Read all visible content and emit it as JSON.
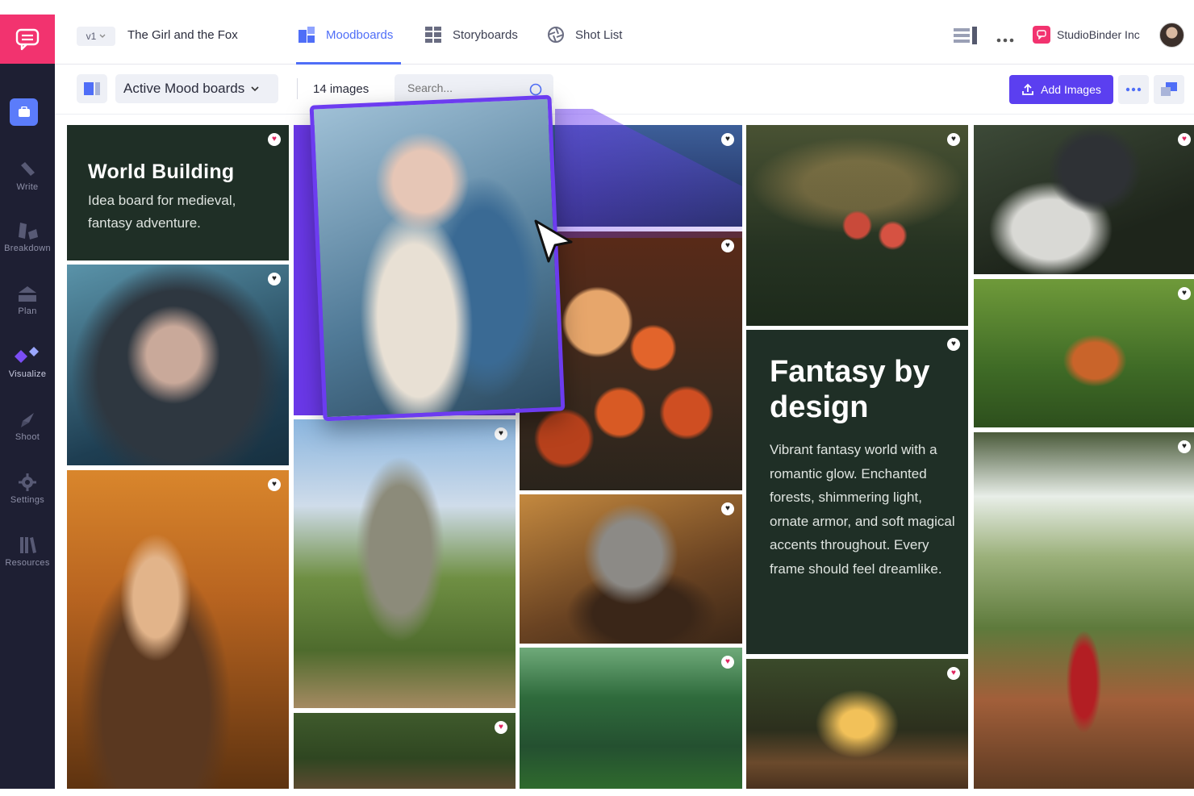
{
  "sidebar": {
    "items": [
      {
        "label": "Write",
        "icon": "pen-icon"
      },
      {
        "label": "Breakdown",
        "icon": "breakdown-icon"
      },
      {
        "label": "Plan",
        "icon": "plan-icon"
      },
      {
        "label": "Visualize",
        "icon": "visualize-icon"
      },
      {
        "label": "Shoot",
        "icon": "shoot-icon"
      },
      {
        "label": "Settings",
        "icon": "gear-icon"
      },
      {
        "label": "Resources",
        "icon": "books-icon"
      }
    ]
  },
  "header": {
    "version": "v1",
    "project_title": "The Girl and the Fox",
    "tabs": [
      {
        "label": "Moodboards",
        "active": true
      },
      {
        "label": "Storyboards",
        "active": false
      },
      {
        "label": "Shot List",
        "active": false
      }
    ],
    "company": "StudioBinder Inc"
  },
  "toolbar": {
    "board_select": "Active Mood boards",
    "image_count": "14 images",
    "search_placeholder": "Search...",
    "add_label": "Add Images"
  },
  "cards": {
    "world_building": {
      "title": "World Building",
      "subtitle": "Idea board for medieval, fantasy adventure."
    },
    "fantasy": {
      "title": "Fantasy by design",
      "subtitle": "Vibrant fantasy world with a romantic glow. Enchanted forests, shimmering light, ornate armor, and soft magical accents throughout. Every frame should feel dreamlike."
    }
  },
  "colors": {
    "accent": "#4f6ef7",
    "brand": "#f2336f",
    "primary_button": "#5b3ff0",
    "sidebar": "#1e1f33",
    "card": "#1f2f26",
    "highlight": "#6a38e8"
  }
}
